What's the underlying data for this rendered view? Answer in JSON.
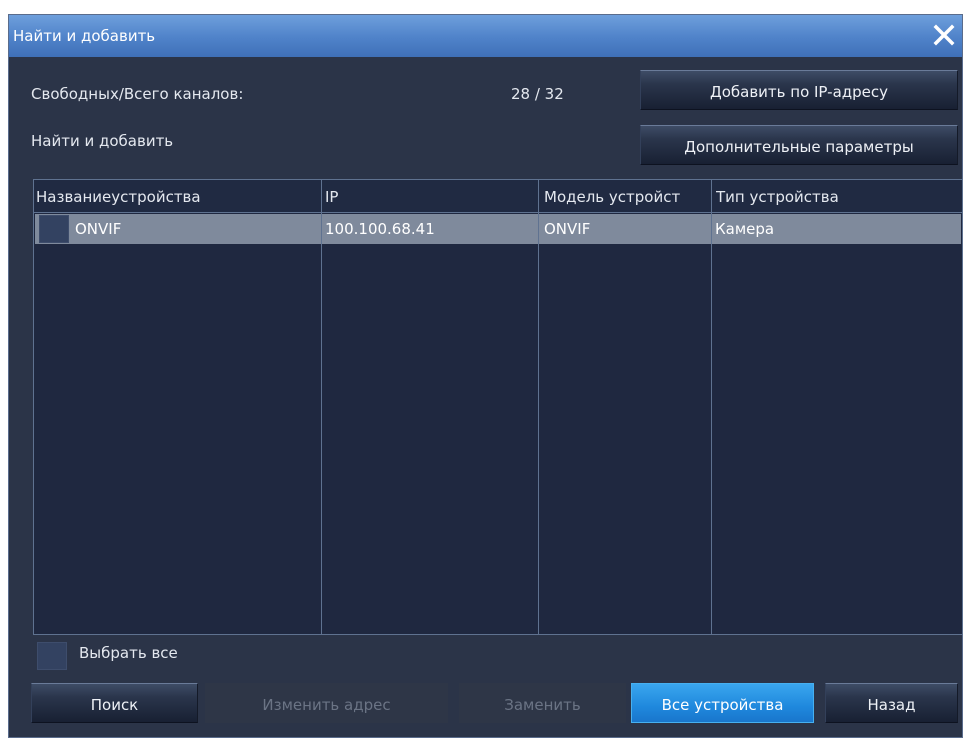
{
  "window": {
    "title": "Найти и добавить",
    "close_icon": "close-icon"
  },
  "channels": {
    "label": "Свободных/Всего каналов:",
    "value": "28 / 32"
  },
  "section_label": "Найти и добавить",
  "buttons": {
    "add_by_ip": "Добавить по IP-адресу",
    "advanced": "Дополнительные параметры",
    "search": "Поиск",
    "change_address": "Изменить адрес",
    "replace": "Заменить",
    "all_devices": "Все устройства",
    "back": "Назад"
  },
  "table": {
    "columns": [
      "Названиеустройства",
      "IP",
      "Модель устройст",
      "Тип устройства"
    ],
    "rows": [
      {
        "name": "ONVIF",
        "ip": "100.100.68.41",
        "model": "ONVIF",
        "type": "Камера"
      }
    ]
  },
  "select_all": "Выбрать все",
  "colors": {
    "accent": "#1f88dd",
    "titlebar": "#4f82c9",
    "background": "#2b3448",
    "selected_row": "#7f8a9c"
  }
}
